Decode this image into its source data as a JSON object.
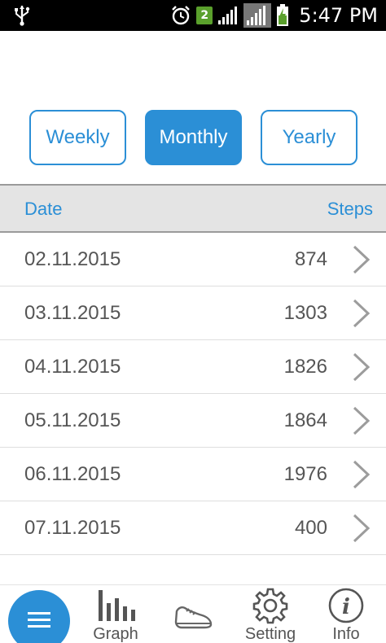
{
  "status_bar": {
    "notification_count": "2",
    "time": "5:47 PM"
  },
  "period_selector": {
    "weekly": "Weekly",
    "monthly": "Monthly",
    "yearly": "Yearly",
    "selected": "Monthly"
  },
  "table": {
    "header": {
      "date": "Date",
      "steps": "Steps"
    },
    "rows": [
      {
        "date": "02.11.2015",
        "steps": "874"
      },
      {
        "date": "03.11.2015",
        "steps": "1303"
      },
      {
        "date": "04.11.2015",
        "steps": "1826"
      },
      {
        "date": "05.11.2015",
        "steps": "1864"
      },
      {
        "date": "06.11.2015",
        "steps": "1976"
      },
      {
        "date": "07.11.2015",
        "steps": "400"
      }
    ]
  },
  "bottom_nav": {
    "graph": "Graph",
    "setting": "Setting",
    "info": "Info"
  },
  "colors": {
    "accent": "#2b8fd6",
    "header_bg": "#e4e4e4",
    "text": "#555555"
  }
}
